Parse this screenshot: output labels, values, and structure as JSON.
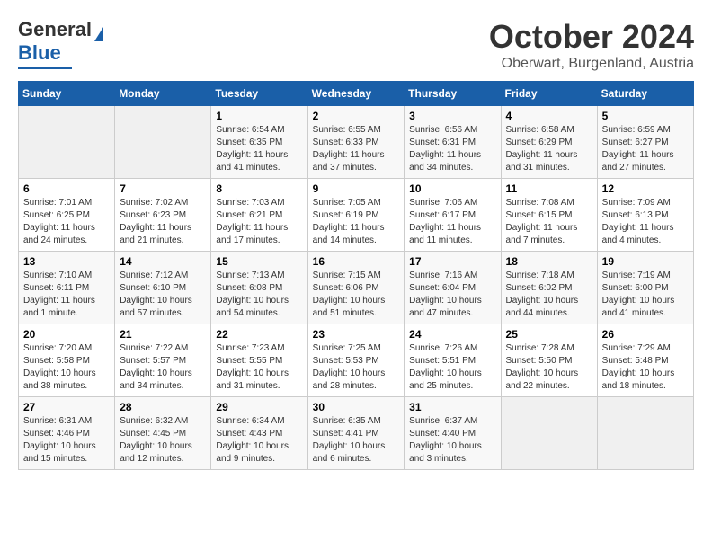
{
  "header": {
    "logo_general": "General",
    "logo_blue": "Blue",
    "month_title": "October 2024",
    "location": "Oberwart, Burgenland, Austria"
  },
  "days_of_week": [
    "Sunday",
    "Monday",
    "Tuesday",
    "Wednesday",
    "Thursday",
    "Friday",
    "Saturday"
  ],
  "weeks": [
    [
      {
        "day": "",
        "empty": true
      },
      {
        "day": "",
        "empty": true
      },
      {
        "day": "1",
        "sunrise": "6:54 AM",
        "sunset": "6:35 PM",
        "daylight": "11 hours and 41 minutes."
      },
      {
        "day": "2",
        "sunrise": "6:55 AM",
        "sunset": "6:33 PM",
        "daylight": "11 hours and 37 minutes."
      },
      {
        "day": "3",
        "sunrise": "6:56 AM",
        "sunset": "6:31 PM",
        "daylight": "11 hours and 34 minutes."
      },
      {
        "day": "4",
        "sunrise": "6:58 AM",
        "sunset": "6:29 PM",
        "daylight": "11 hours and 31 minutes."
      },
      {
        "day": "5",
        "sunrise": "6:59 AM",
        "sunset": "6:27 PM",
        "daylight": "11 hours and 27 minutes."
      }
    ],
    [
      {
        "day": "6",
        "sunrise": "7:01 AM",
        "sunset": "6:25 PM",
        "daylight": "11 hours and 24 minutes."
      },
      {
        "day": "7",
        "sunrise": "7:02 AM",
        "sunset": "6:23 PM",
        "daylight": "11 hours and 21 minutes."
      },
      {
        "day": "8",
        "sunrise": "7:03 AM",
        "sunset": "6:21 PM",
        "daylight": "11 hours and 17 minutes."
      },
      {
        "day": "9",
        "sunrise": "7:05 AM",
        "sunset": "6:19 PM",
        "daylight": "11 hours and 14 minutes."
      },
      {
        "day": "10",
        "sunrise": "7:06 AM",
        "sunset": "6:17 PM",
        "daylight": "11 hours and 11 minutes."
      },
      {
        "day": "11",
        "sunrise": "7:08 AM",
        "sunset": "6:15 PM",
        "daylight": "11 hours and 7 minutes."
      },
      {
        "day": "12",
        "sunrise": "7:09 AM",
        "sunset": "6:13 PM",
        "daylight": "11 hours and 4 minutes."
      }
    ],
    [
      {
        "day": "13",
        "sunrise": "7:10 AM",
        "sunset": "6:11 PM",
        "daylight": "11 hours and 1 minute."
      },
      {
        "day": "14",
        "sunrise": "7:12 AM",
        "sunset": "6:10 PM",
        "daylight": "10 hours and 57 minutes."
      },
      {
        "day": "15",
        "sunrise": "7:13 AM",
        "sunset": "6:08 PM",
        "daylight": "10 hours and 54 minutes."
      },
      {
        "day": "16",
        "sunrise": "7:15 AM",
        "sunset": "6:06 PM",
        "daylight": "10 hours and 51 minutes."
      },
      {
        "day": "17",
        "sunrise": "7:16 AM",
        "sunset": "6:04 PM",
        "daylight": "10 hours and 47 minutes."
      },
      {
        "day": "18",
        "sunrise": "7:18 AM",
        "sunset": "6:02 PM",
        "daylight": "10 hours and 44 minutes."
      },
      {
        "day": "19",
        "sunrise": "7:19 AM",
        "sunset": "6:00 PM",
        "daylight": "10 hours and 41 minutes."
      }
    ],
    [
      {
        "day": "20",
        "sunrise": "7:20 AM",
        "sunset": "5:58 PM",
        "daylight": "10 hours and 38 minutes."
      },
      {
        "day": "21",
        "sunrise": "7:22 AM",
        "sunset": "5:57 PM",
        "daylight": "10 hours and 34 minutes."
      },
      {
        "day": "22",
        "sunrise": "7:23 AM",
        "sunset": "5:55 PM",
        "daylight": "10 hours and 31 minutes."
      },
      {
        "day": "23",
        "sunrise": "7:25 AM",
        "sunset": "5:53 PM",
        "daylight": "10 hours and 28 minutes."
      },
      {
        "day": "24",
        "sunrise": "7:26 AM",
        "sunset": "5:51 PM",
        "daylight": "10 hours and 25 minutes."
      },
      {
        "day": "25",
        "sunrise": "7:28 AM",
        "sunset": "5:50 PM",
        "daylight": "10 hours and 22 minutes."
      },
      {
        "day": "26",
        "sunrise": "7:29 AM",
        "sunset": "5:48 PM",
        "daylight": "10 hours and 18 minutes."
      }
    ],
    [
      {
        "day": "27",
        "sunrise": "6:31 AM",
        "sunset": "4:46 PM",
        "daylight": "10 hours and 15 minutes."
      },
      {
        "day": "28",
        "sunrise": "6:32 AM",
        "sunset": "4:45 PM",
        "daylight": "10 hours and 12 minutes."
      },
      {
        "day": "29",
        "sunrise": "6:34 AM",
        "sunset": "4:43 PM",
        "daylight": "10 hours and 9 minutes."
      },
      {
        "day": "30",
        "sunrise": "6:35 AM",
        "sunset": "4:41 PM",
        "daylight": "10 hours and 6 minutes."
      },
      {
        "day": "31",
        "sunrise": "6:37 AM",
        "sunset": "4:40 PM",
        "daylight": "10 hours and 3 minutes."
      },
      {
        "day": "",
        "empty": true
      },
      {
        "day": "",
        "empty": true
      }
    ]
  ]
}
